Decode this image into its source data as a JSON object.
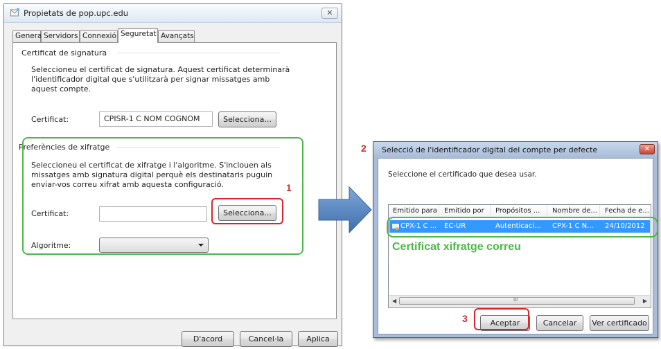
{
  "dialog1": {
    "title": "Propietats de pop.upc.edu",
    "close_glyph": "✕",
    "tabs": [
      {
        "label": "General"
      },
      {
        "label": "Servidors"
      },
      {
        "label": "Connexió"
      },
      {
        "label": "Seguretat"
      },
      {
        "label": "Avançats"
      }
    ],
    "signing": {
      "group_title": "Certificat de signatura",
      "description_lines": [
        "Seleccioneu el certificat de signatura. Aquest certificat determinarà",
        "l'identificador digital que s'utilitzarà per signar missatges amb",
        "aquest compte."
      ],
      "cert_label": "Certificat:",
      "cert_value": "CPISR-1 C NOM COGNOM",
      "select_button": "Selecciona..."
    },
    "encryption": {
      "group_title": "Preferències de xifratge",
      "description_lines": [
        "Seleccioneu el certificat de xifratge i l'algoritme. S'inclouen als",
        "missatges amb signatura digital perquè els destinataris puguin",
        "enviar-vos correu xifrat amb aquesta configuració."
      ],
      "cert_label": "Certificat:",
      "cert_value": "",
      "select_button": "Selecciona...",
      "algorithm_label": "Algoritme:",
      "algorithm_value": ""
    },
    "buttons": {
      "ok": "D'acord",
      "cancel": "Cancel·la",
      "apply": "Aplica"
    }
  },
  "dialog2": {
    "title": "Selecció de l'identificador digital del compte per defecte",
    "close_glyph": "✕",
    "prompt": "Seleccione el certificado que desea usar.",
    "columns": [
      "Emitido para",
      "Emitido por",
      "Propósitos ...",
      "Nombre de...",
      "Fecha de e..."
    ],
    "rows": [
      {
        "issued_to": "CPX-1 C ...",
        "issued_by": "EC-UR",
        "purposes": "Autenticaci...",
        "name": "CPX-1 C N...",
        "date": "24/10/2012"
      }
    ],
    "scroll_glyph": "III",
    "buttons": {
      "accept": "Aceptar",
      "cancel": "Cancelar",
      "view": "Ver certificado"
    }
  },
  "annotations": {
    "step1": "1",
    "step2": "2",
    "step3": "3",
    "highlight_text": "Certificat xifratge correu"
  },
  "colors": {
    "green": "#4cb848",
    "red": "#d9242b",
    "arrow_blue": "#4f81bd",
    "selection": "#3399ff"
  }
}
